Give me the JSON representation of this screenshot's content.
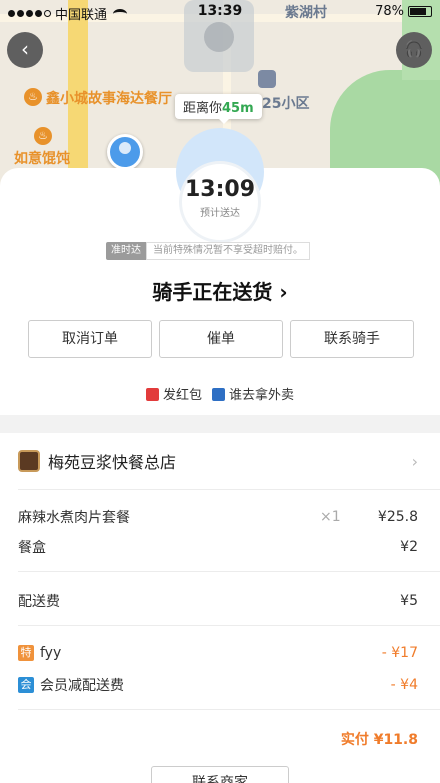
{
  "status_bar": {
    "carrier": "中国联通",
    "time": "13:39",
    "battery": "78%"
  },
  "map": {
    "labels": {
      "shop_poi": "鑫小城故事海达餐厅",
      "restaurant_poi": "如意馄饨",
      "community": "25小区",
      "village": "紫湖村"
    },
    "distance_prefix": "距离你",
    "distance_value": "45m"
  },
  "delivery": {
    "eta_time": "13:09",
    "eta_label": "预计送达",
    "punctual_tag": "准时达",
    "punctual_note": "当前特殊情况暂不享受超时赔付。",
    "status_text": "骑手正在送货",
    "actions": [
      "取消订单",
      "催单",
      "联系骑手"
    ],
    "share": {
      "red_packet": "发红包",
      "who_picks": "谁去拿外卖"
    }
  },
  "order": {
    "shop_name": "梅苑豆浆快餐总店",
    "items": [
      {
        "name": "麻辣水煮肉片套餐",
        "qty": "×1",
        "price": "¥25.8"
      },
      {
        "name": "餐盒",
        "qty": "",
        "price": "¥2"
      }
    ],
    "delivery_fee": {
      "label": "配送费",
      "price": "¥5"
    },
    "discounts": [
      {
        "badge": "特",
        "label": "fyy",
        "amount": "- ¥17"
      },
      {
        "badge": "会",
        "label": "会员减配送费",
        "amount": "- ¥4"
      }
    ],
    "total": "实付 ¥11.8",
    "contact_shop": "联系商家"
  },
  "colors": {
    "accent_orange": "#f07c2b",
    "distance_green": "#33a852",
    "eta_ring": "#d2e6fa"
  }
}
